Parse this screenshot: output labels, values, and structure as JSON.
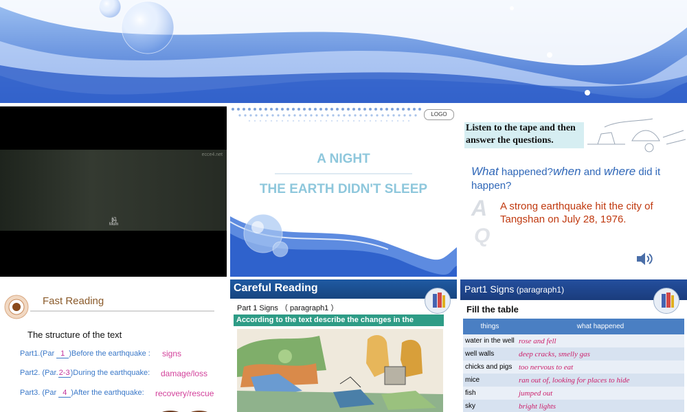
{
  "slide2": {
    "logo": "LOGO",
    "title_line1": "A NIGHT",
    "title_line2": "THE EARTH DIDN'T SLEEP"
  },
  "slide1": {
    "watermark": "ecce4.net",
    "subtitle_cn": "妈",
    "subtitle_en": "Mom"
  },
  "slide3": {
    "instruction": "Listen to the tape and then answer the questions.",
    "q_what": "What",
    "q_happened": " happened?",
    "q_when": "when",
    "q_and": " and ",
    "q_where": "where",
    "q_rest": " did it happen?",
    "q_letter": "Q",
    "a_letter": "A",
    "answer": "A strong earthquake hit the city of Tangshan on July 28, 1976."
  },
  "slide4": {
    "title": "Fast Reading",
    "structure": "The structure of the text",
    "parts": [
      {
        "prefix": "Part1.(Par",
        "num": "1",
        "suffix": ")Before the earthquake :",
        "answer": "signs"
      },
      {
        "prefix": "Part2. (Par.",
        "num": "2-3",
        "suffix": ")During the earthquake:",
        "answer": "damage/loss"
      },
      {
        "prefix": "Part3. (Par",
        "num": "4",
        "suffix": ")After the earthquake:",
        "answer": "recovery/rescue"
      }
    ]
  },
  "slide5": {
    "title": "Careful Reading",
    "subtitle": "Part 1  Signs  （ paragraph1 ）",
    "instruction": "According to the text describe the changes in the pictures."
  },
  "slide6": {
    "title": "Part1 Signs",
    "title_small": " (paragraph1)",
    "fill": "Fill the table",
    "headers": [
      "things",
      "what  happened"
    ],
    "rows": [
      [
        "water in the well",
        "rose and fell"
      ],
      [
        "well walls",
        "deep cracks, smelly gas"
      ],
      [
        "chicks and pigs",
        "too nervous to eat"
      ],
      [
        "mice",
        "ran out of, looking for places to hide"
      ],
      [
        "fish",
        "jumped out"
      ],
      [
        "sky",
        "bright lights"
      ]
    ]
  },
  "colors": {
    "banner_blue": "#5a86dc",
    "title_teal": "#8ec7dc",
    "answer_red": "#c0390f",
    "table_header": "#4a7fc3",
    "ink_pink": "#cc1f6a"
  }
}
